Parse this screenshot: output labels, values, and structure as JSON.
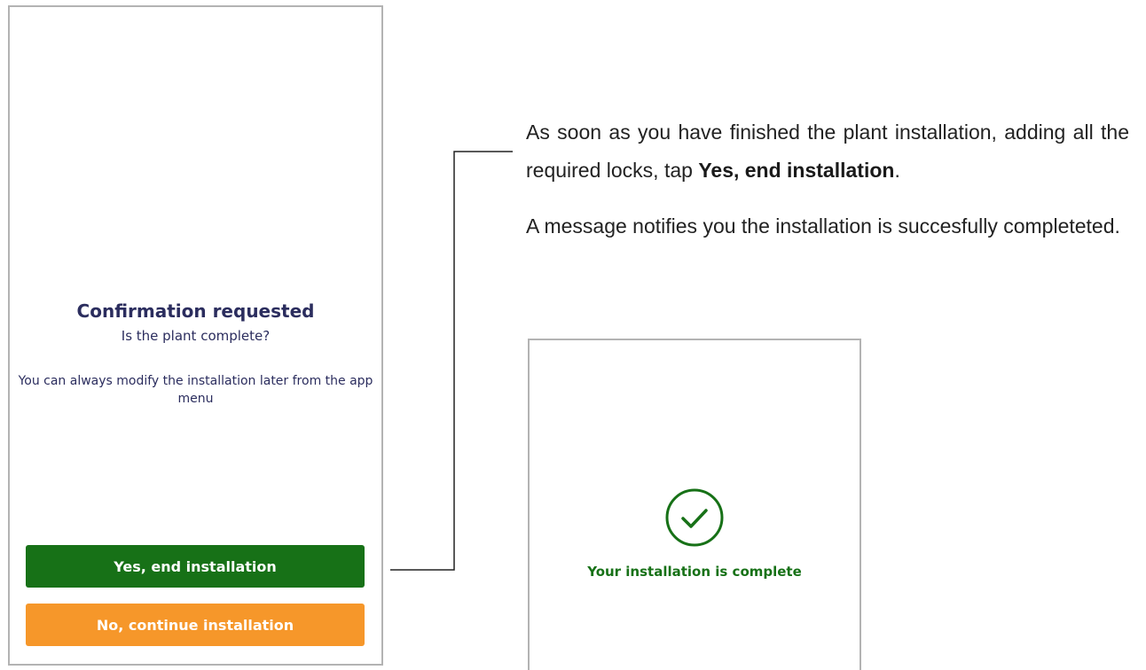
{
  "confirm_dialog": {
    "title": "Confirmation requested",
    "subtitle": "Is the plant complete?",
    "note": "You can always modify the installation later from the app menu",
    "yes_button": "Yes, end installation",
    "no_button": "No, continue installation"
  },
  "instructions": {
    "p1_before": "As soon as you have finished the plant installation, adding all the required locks, tap ",
    "p1_bold": "Yes, end installation",
    "p1_after": ".",
    "p2": "A message notifies you the installation is succesfully completeted."
  },
  "success_screen": {
    "icon": "check-circle-icon",
    "message": "Your installation is complete"
  },
  "colors": {
    "primary_green": "#177117",
    "orange": "#f6972a",
    "dialog_text": "#2b2d5e"
  }
}
